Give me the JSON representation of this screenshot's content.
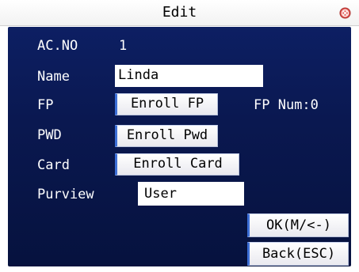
{
  "window": {
    "title": "Edit"
  },
  "fields": {
    "acno_label": "AC.NO",
    "acno_value": "1",
    "name_label": "Name",
    "name_value": "Linda",
    "fp_label": "FP",
    "fp_button": "Enroll FP",
    "fp_num": "FP Num:0",
    "pwd_label": "PWD",
    "pwd_button": "Enroll Pwd",
    "card_label": "Card",
    "card_button": "Enroll Card",
    "purview_label": "Purview",
    "purview_value": "User"
  },
  "actions": {
    "ok_label": "OK(M/<-)",
    "back_label": "Back(ESC)"
  },
  "icons": {
    "close": "close-icon"
  },
  "colors": {
    "panel": "#0a1850",
    "accent": "#3d6fd6",
    "close_red": "#d9534f"
  }
}
